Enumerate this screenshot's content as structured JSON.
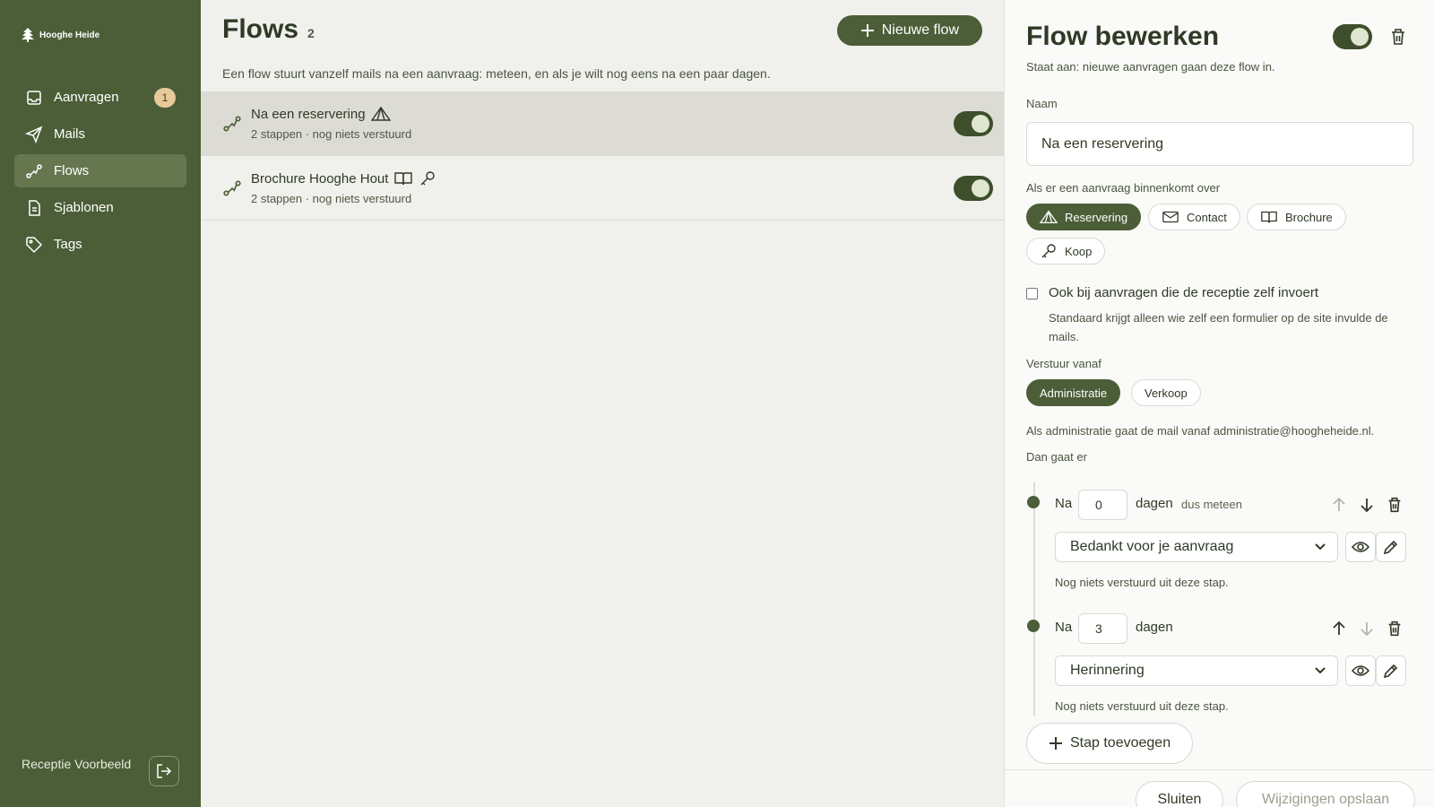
{
  "brand": {
    "name": "Hooghe Heide"
  },
  "sidebar": {
    "items": [
      {
        "label": "Aanvragen",
        "icon": "inbox-icon",
        "badge": "1"
      },
      {
        "label": "Mails",
        "icon": "send-icon"
      },
      {
        "label": "Flows",
        "icon": "route-icon",
        "active": true
      },
      {
        "label": "Sjablonen",
        "icon": "document-icon"
      },
      {
        "label": "Tags",
        "icon": "tag-icon"
      }
    ],
    "user": "Receptie Voorbeeld"
  },
  "main": {
    "title": "Flows",
    "count": "2",
    "new_button": "Nieuwe flow",
    "description": "Een flow stuurt vanzelf mails na een aanvraag: meteen, en als je wilt nog eens na een paar dagen.",
    "flows": [
      {
        "name": "Na een reservering",
        "meta": "2 stappen · nog niets verstuurd",
        "icons": [
          "tent-icon"
        ],
        "enabled": true,
        "selected": true
      },
      {
        "name": "Brochure Hooghe Hout",
        "meta": "2 stappen · nog niets verstuurd",
        "icons": [
          "book-icon",
          "key-icon"
        ],
        "enabled": true
      }
    ]
  },
  "panel": {
    "title": "Flow bewerken",
    "enabled": true,
    "status": "Staat aan: nieuwe aanvragen gaan deze flow in.",
    "name_label": "Naam",
    "name_value": "Na een reservering",
    "trigger_label": "Als er een aanvraag binnenkomt over",
    "triggers": [
      {
        "label": "Reservering",
        "icon": "tent-icon",
        "active": true
      },
      {
        "label": "Contact",
        "icon": "mail-icon"
      },
      {
        "label": "Brochure",
        "icon": "book-icon"
      },
      {
        "label": "Koop",
        "icon": "key-icon"
      }
    ],
    "reception_checkbox_label": "Ook bij aanvragen die de receptie zelf invoert",
    "reception_checkbox_checked": false,
    "reception_help": "Standaard krijgt alleen wie zelf een formulier op de site invulde de mails.",
    "sender_label": "Verstuur vanaf",
    "senders": [
      {
        "label": "Administratie",
        "active": true
      },
      {
        "label": "Verkoop"
      }
    ],
    "sender_note": "Als administratie gaat de mail vanaf administratie@hoogheheide.nl.",
    "steps_label": "Dan gaat er",
    "steps": [
      {
        "prefix": "Na",
        "days": "0",
        "unit": "dagen",
        "hint": "dus meteen",
        "template": "Bedankt voor je aanvraag",
        "note": "Nog niets verstuurd uit deze stap."
      },
      {
        "prefix": "Na",
        "days": "3",
        "unit": "dagen",
        "hint": "",
        "template": "Herinnering",
        "note": "Nog niets verstuurd uit deze stap."
      }
    ],
    "add_step": "Stap toevoegen",
    "close_button": "Sluiten",
    "save_button": "Wijzigingen opslaan"
  },
  "colors": {
    "primary": "#4b5e37",
    "badge": "#e7c99a",
    "selected_row": "#dcdcd5"
  }
}
